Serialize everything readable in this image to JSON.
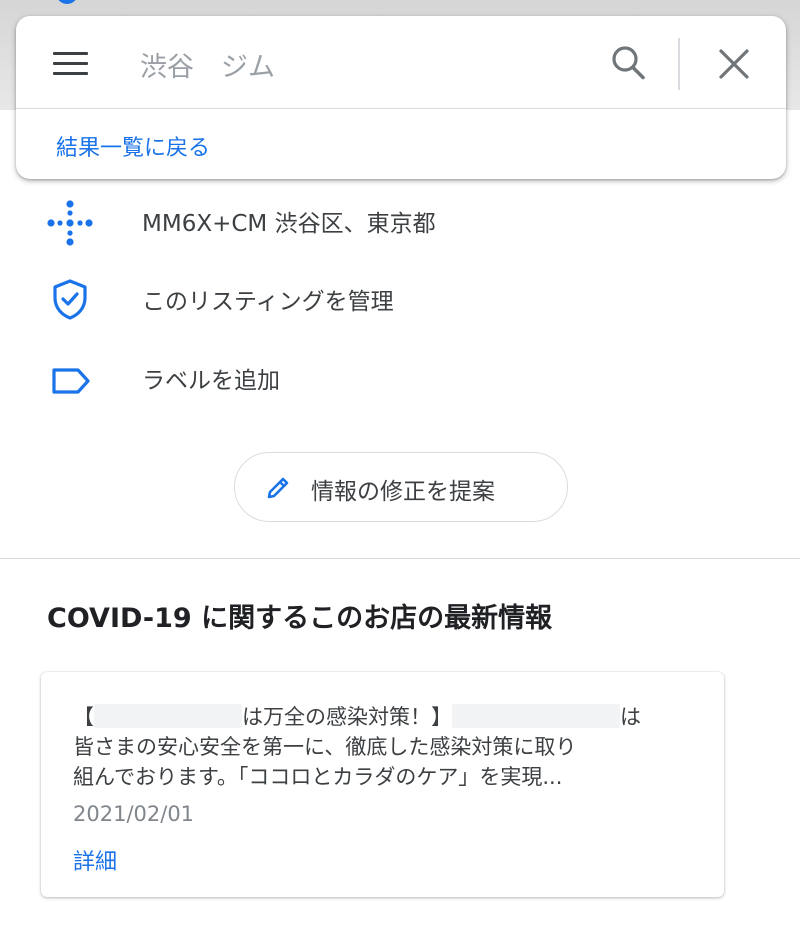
{
  "search": {
    "query": "渋谷　ジム",
    "back_label": "結果一覧に戻る"
  },
  "info_rows": [
    {
      "icon": "plus-code-icon",
      "label": "MM6X+CM 渋谷区、東京都"
    },
    {
      "icon": "verified-shield-icon",
      "label": "このリスティングを管理"
    },
    {
      "icon": "label-tag-icon",
      "label": "ラベルを追加"
    }
  ],
  "suggest_edit": {
    "label": "情報の修正を提案"
  },
  "covid": {
    "title": "COVID-19 に関するこのお店の最新情報",
    "update": {
      "line1_a": "【",
      "line1_b": "は万全の感染対策！】",
      "line1_c": "は",
      "line2": "皆さまの安心安全を第一に、徹底した感染対策に取り",
      "line3": "組んでおります。「ココロとカラダのケア」を実現...",
      "date": "2021/02/01",
      "more_label": "詳細"
    }
  },
  "colors": {
    "accent": "#1a73e8",
    "text": "#3c4043",
    "muted": "#80868b",
    "divider": "#dadce0"
  }
}
